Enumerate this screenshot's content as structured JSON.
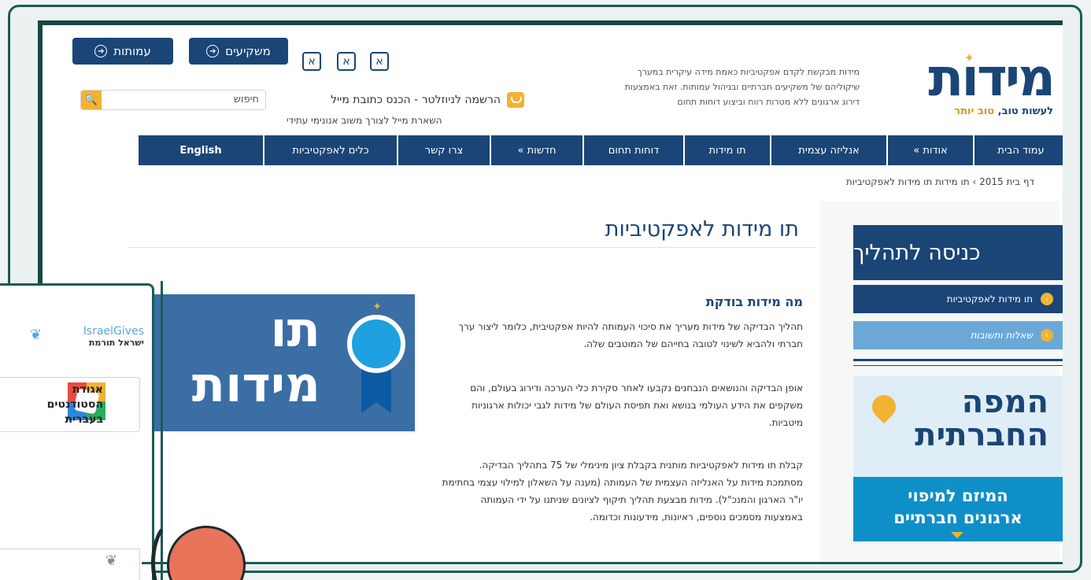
{
  "header": {
    "btn_amutot": "עמותות",
    "btn_mashkiim": "משקיעים",
    "font_buttons": [
      "א",
      "א",
      "א"
    ],
    "search_label": "חיפוש",
    "newsletter": "הרשמה לניוזלטר - הכנס כתובת מייל",
    "newsletter_sub": "השארת מייל לצורך משוב אנונימי עתידי",
    "tagline": "מידות מבקשת לקדם אפקטיביות כאמת מידה עיקרית במערך שיקוליהם של משקיעים חברתיים ובניהול עמותות. זאת באמצעות דירוג ארגונים ללא מטרות רווח וביצוע דוחות תחום",
    "logo_word": "מידות",
    "logo_slogan_a": "לעשות טוב,",
    "logo_slogan_b": "טוב יותר"
  },
  "nav": {
    "items": [
      "עמוד הבית",
      "אודות »",
      "אנליזה עצמית",
      "תו מידות",
      "דוחות תחום",
      "חדשות »",
      "צרו קשר",
      "כלים לאפקטיביות",
      "English"
    ]
  },
  "breadcrumb": "דף בית 2015 › תו מידות תו מידות לאפקטיביות",
  "main": {
    "title": "תו מידות לאפקטיביות",
    "section_title": "מה מידות בודקת",
    "para1": "תהליך הבדיקה של מידות מעריך את סיכוי העמותה להיות אפקטיבית, כלומר ליצור ערך חברתי ולהביא לשינוי לטובה בחייהם של המוטבים שלה.",
    "para2": "אופן הבדיקה והנושאים הנבחנים נקבעו לאחר סקירת כלי הערכה ודירוג בעולם, והם משקפים את הידע העולמי בנושא ואת תפיסת העולם של מידות לגבי יכולות ארגוניות מיטביות.",
    "para3": "קבלת תו מידות לאפקטיביות מותנית בקבלת ציון מינימלי של 75 בתהליך הבדיקה. מסתמכת מידות על האנליזה העצמית של העמותה (מענה על השאלון למילוי עצמי בחתימת יו\"ר הארגון והמנכ\"ל). מידות מבצעת תהליך תיקוף לציונים שניתנו על ידי העמותה באמצעות מסמכים נוספים, ראיונות, מידעונות וכדומה.",
    "seal_line1": "תו",
    "seal_line2": "מידות"
  },
  "sidebar": {
    "head": "כניסה לתהליך",
    "item_active": "תו מידות לאפקטיביות",
    "item_faq": "שאלות ותשובות",
    "banner_title_1": "המפה",
    "banner_title_2": "החברתית",
    "banner_text_1": "המיזם למיפוי",
    "banner_text_2": "ארגונים חברתיים"
  },
  "overlay": {
    "israelgives": "IsraelGives",
    "israelgives_he": "ישראל תורמת",
    "org_name": "אגודת הסטודנטים בעברית"
  },
  "colors": {
    "primary": "#1b4576",
    "accent": "#f2b233",
    "frame": "#1d5a57",
    "banner": "#0f8fc8"
  }
}
